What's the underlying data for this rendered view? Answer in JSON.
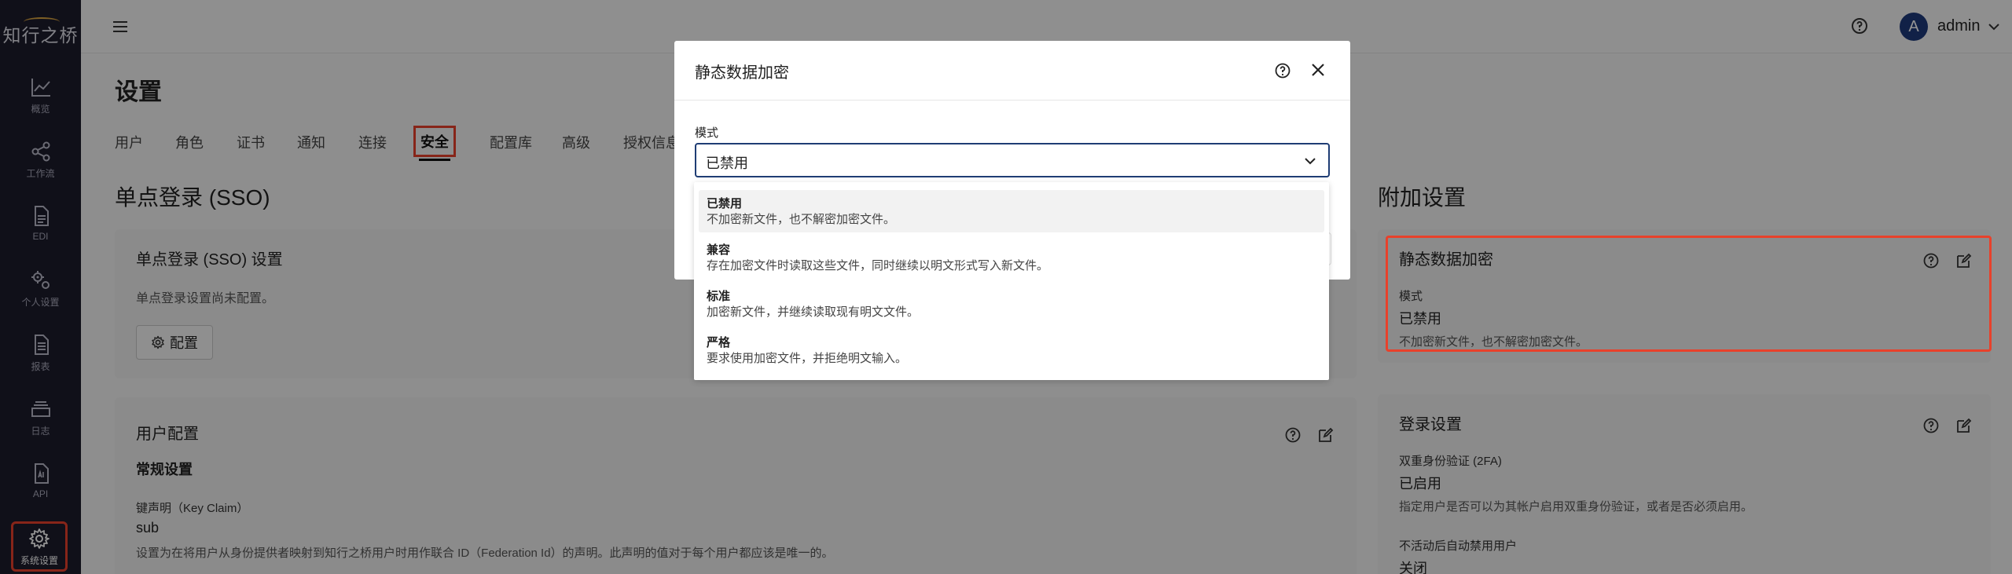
{
  "app": {
    "logo_text": "知行之桥"
  },
  "sidebar": {
    "items": [
      {
        "label": "概览",
        "icon": "chart-line-icon"
      },
      {
        "label": "工作流",
        "icon": "share-nodes-icon"
      },
      {
        "label": "EDI",
        "icon": "document-icon"
      },
      {
        "label": "个人设置",
        "icon": "gears-icon"
      },
      {
        "label": "报表",
        "icon": "report-icon"
      },
      {
        "label": "日志",
        "icon": "log-stack-icon"
      },
      {
        "label": "API",
        "icon": "api-file-icon"
      },
      {
        "label": "系统设置",
        "icon": "gear-icon",
        "active": true
      }
    ]
  },
  "topbar": {
    "user_initial": "A",
    "user_name": "admin"
  },
  "page": {
    "title": "设置",
    "tabs": [
      "用户",
      "角色",
      "证书",
      "通知",
      "连接",
      "安全",
      "配置库",
      "高级",
      "授权信息"
    ],
    "active_tab": "安全"
  },
  "sso": {
    "section_title": "单点登录 (SSO)",
    "card_title": "单点登录 (SSO) 设置",
    "text": "单点登录设置尚未配置。",
    "config_button": "配置"
  },
  "user_config": {
    "card_title": "用户配置",
    "subtitle": "常规设置",
    "key_claim_label": "键声明（Key Claim）",
    "key_claim_value": "sub",
    "key_claim_desc": "设置为在将用户从身份提供者映射到知行之桥用户时用作联合 ID（Federation Id）的声明。此声明的值对于每个用户都应该是唯一的。"
  },
  "additional": {
    "section_title": "附加设置",
    "encryption": {
      "card_title": "静态数据加密",
      "mode_label": "模式",
      "mode_value": "已禁用",
      "mode_desc": "不加密新文件，也不解密加密文件。"
    },
    "login": {
      "card_title": "登录设置",
      "twofa_label": "双重身份验证 (2FA)",
      "twofa_value": "已启用",
      "twofa_desc": "指定用户是否可以为其帐户启用双重身份验证，或者是否必须启用。",
      "inactive_label": "不活动后自动禁用用户",
      "inactive_value": "关闭"
    }
  },
  "modal": {
    "title": "静态数据加密",
    "field_label": "模式",
    "selected_value": "已禁用",
    "options": [
      {
        "title": "已禁用",
        "desc": "不加密新文件，也不解密加密文件。"
      },
      {
        "title": "兼容",
        "desc": "存在加密文件时读取这些文件，同时继续以明文形式写入新文件。"
      },
      {
        "title": "标准",
        "desc": "加密新文件，并继续读取现有明文文件。"
      },
      {
        "title": "严格",
        "desc": "要求使用加密文件，并拒绝明文输入。"
      }
    ]
  },
  "colors": {
    "sidebar_bg": "#1c1c2c",
    "accent_navy": "#1f3d74",
    "highlight_red": "#e8412b",
    "logo_gold": "#d9a441"
  }
}
